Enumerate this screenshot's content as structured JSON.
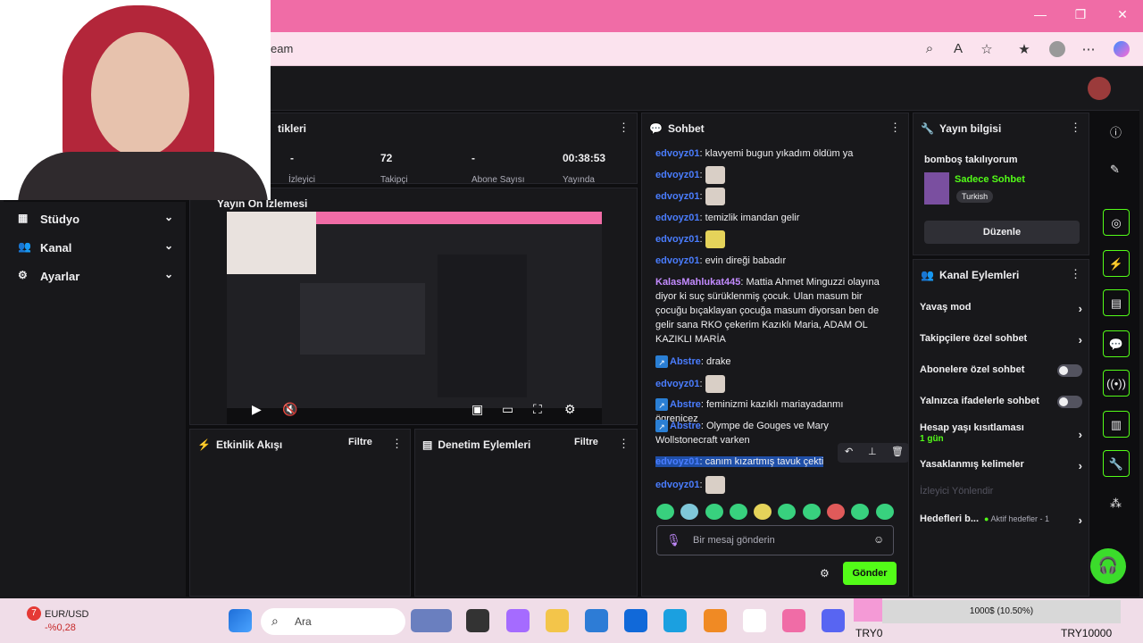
{
  "browser": {
    "url_fragment": "eam"
  },
  "sidebar": {
    "items": [
      {
        "label": "Stüdyo"
      },
      {
        "label": "Kanal"
      },
      {
        "label": "Ayarlar"
      }
    ]
  },
  "stats": {
    "panel_title": "tikleri",
    "values": [
      "-",
      "72",
      "-",
      "00:38:53"
    ],
    "labels": [
      "İzleyici",
      "Takipçi",
      "Abone Sayısı",
      "Yayında"
    ]
  },
  "preview": {
    "title": "Yayın Ön İzlemesi"
  },
  "event_feed": {
    "title": "Etkinlik Akışı",
    "filter": "Filtre"
  },
  "mod_actions": {
    "title": "Denetim Eylemleri",
    "filter": "Filtre"
  },
  "chat": {
    "title": "Sohbet",
    "messages": [
      {
        "user": "edvoyz01",
        "text": ": klavyemi bugun yıkadım öldüm ya"
      },
      {
        "user": "edvoyz01",
        "text": ":"
      },
      {
        "user": "edvoyz01",
        "text": ":"
      },
      {
        "user": "edvoyz01",
        "text": ": temizlik imandan gelir"
      },
      {
        "user": "edvoyz01",
        "text": ":"
      },
      {
        "user": "edvoyz01",
        "text": ": evin direği babadır"
      },
      {
        "user": "KalasMahlukat445",
        "text": ": Mattia Ahmet Minguzzi olayına diyor ki suç sürüklenmiş çocuk. Ulan masum bir çocuğu bıçaklayan çocuğa masum diyorsan ben de gelir sana RKO çekerim Kazıklı Maria, ADAM OL KAZIKLI MARİA"
      },
      {
        "user": "Abstre",
        "text": ": drake"
      },
      {
        "user": "edvoyz01",
        "text": ":"
      },
      {
        "user": "Abstre",
        "text": ": feminizmi kazıklı mariayadanmı ögrenicez"
      },
      {
        "user": "Abstre",
        "text": ": Olympe de Gouges ve Mary Wollstonecraft varken"
      },
      {
        "user": "edvoyz01",
        "text": ": canım kızartmış tavuk çekti"
      },
      {
        "user": "edvoyz01",
        "text": ":"
      }
    ],
    "input_placeholder": "Bir mesaj gönderin",
    "send_label": "Gönder"
  },
  "stream_info": {
    "title": "Yayın bilgisi",
    "stream_title": "bomboş takılıyorum",
    "category": "Sadece Sohbet",
    "language": "Turkish",
    "edit_label": "Düzenle"
  },
  "channel_actions": {
    "title": "Kanal Eylemleri",
    "items": [
      {
        "label": "Yavaş mod"
      },
      {
        "label": "Takipçilere özel sohbet"
      },
      {
        "label": "Abonelere özel sohbet"
      },
      {
        "label": "Yalnızca ifadelerle sohbet"
      },
      {
        "label": "Hesap yaşı kısıtlaması",
        "sub": "1 gün"
      },
      {
        "label": "Yasaklanmış kelimeler"
      },
      {
        "label": "İzleyici Yönlendir"
      },
      {
        "label": "Hedefleri b...",
        "sub": "Aktif hedefler - 1"
      }
    ]
  },
  "taskbar": {
    "currency_pair": "EUR/USD",
    "currency_change": "-%0,28",
    "notif_count": "7",
    "search": "Ara",
    "try_left": "TRY0",
    "try_right": "TRY10000",
    "popup": "1000$ (10.50%)"
  },
  "colors": {
    "accent": "#53fc18",
    "pink": "#f06ca6",
    "chat_user": "#4a7dff",
    "kalas": "#c38bff"
  }
}
